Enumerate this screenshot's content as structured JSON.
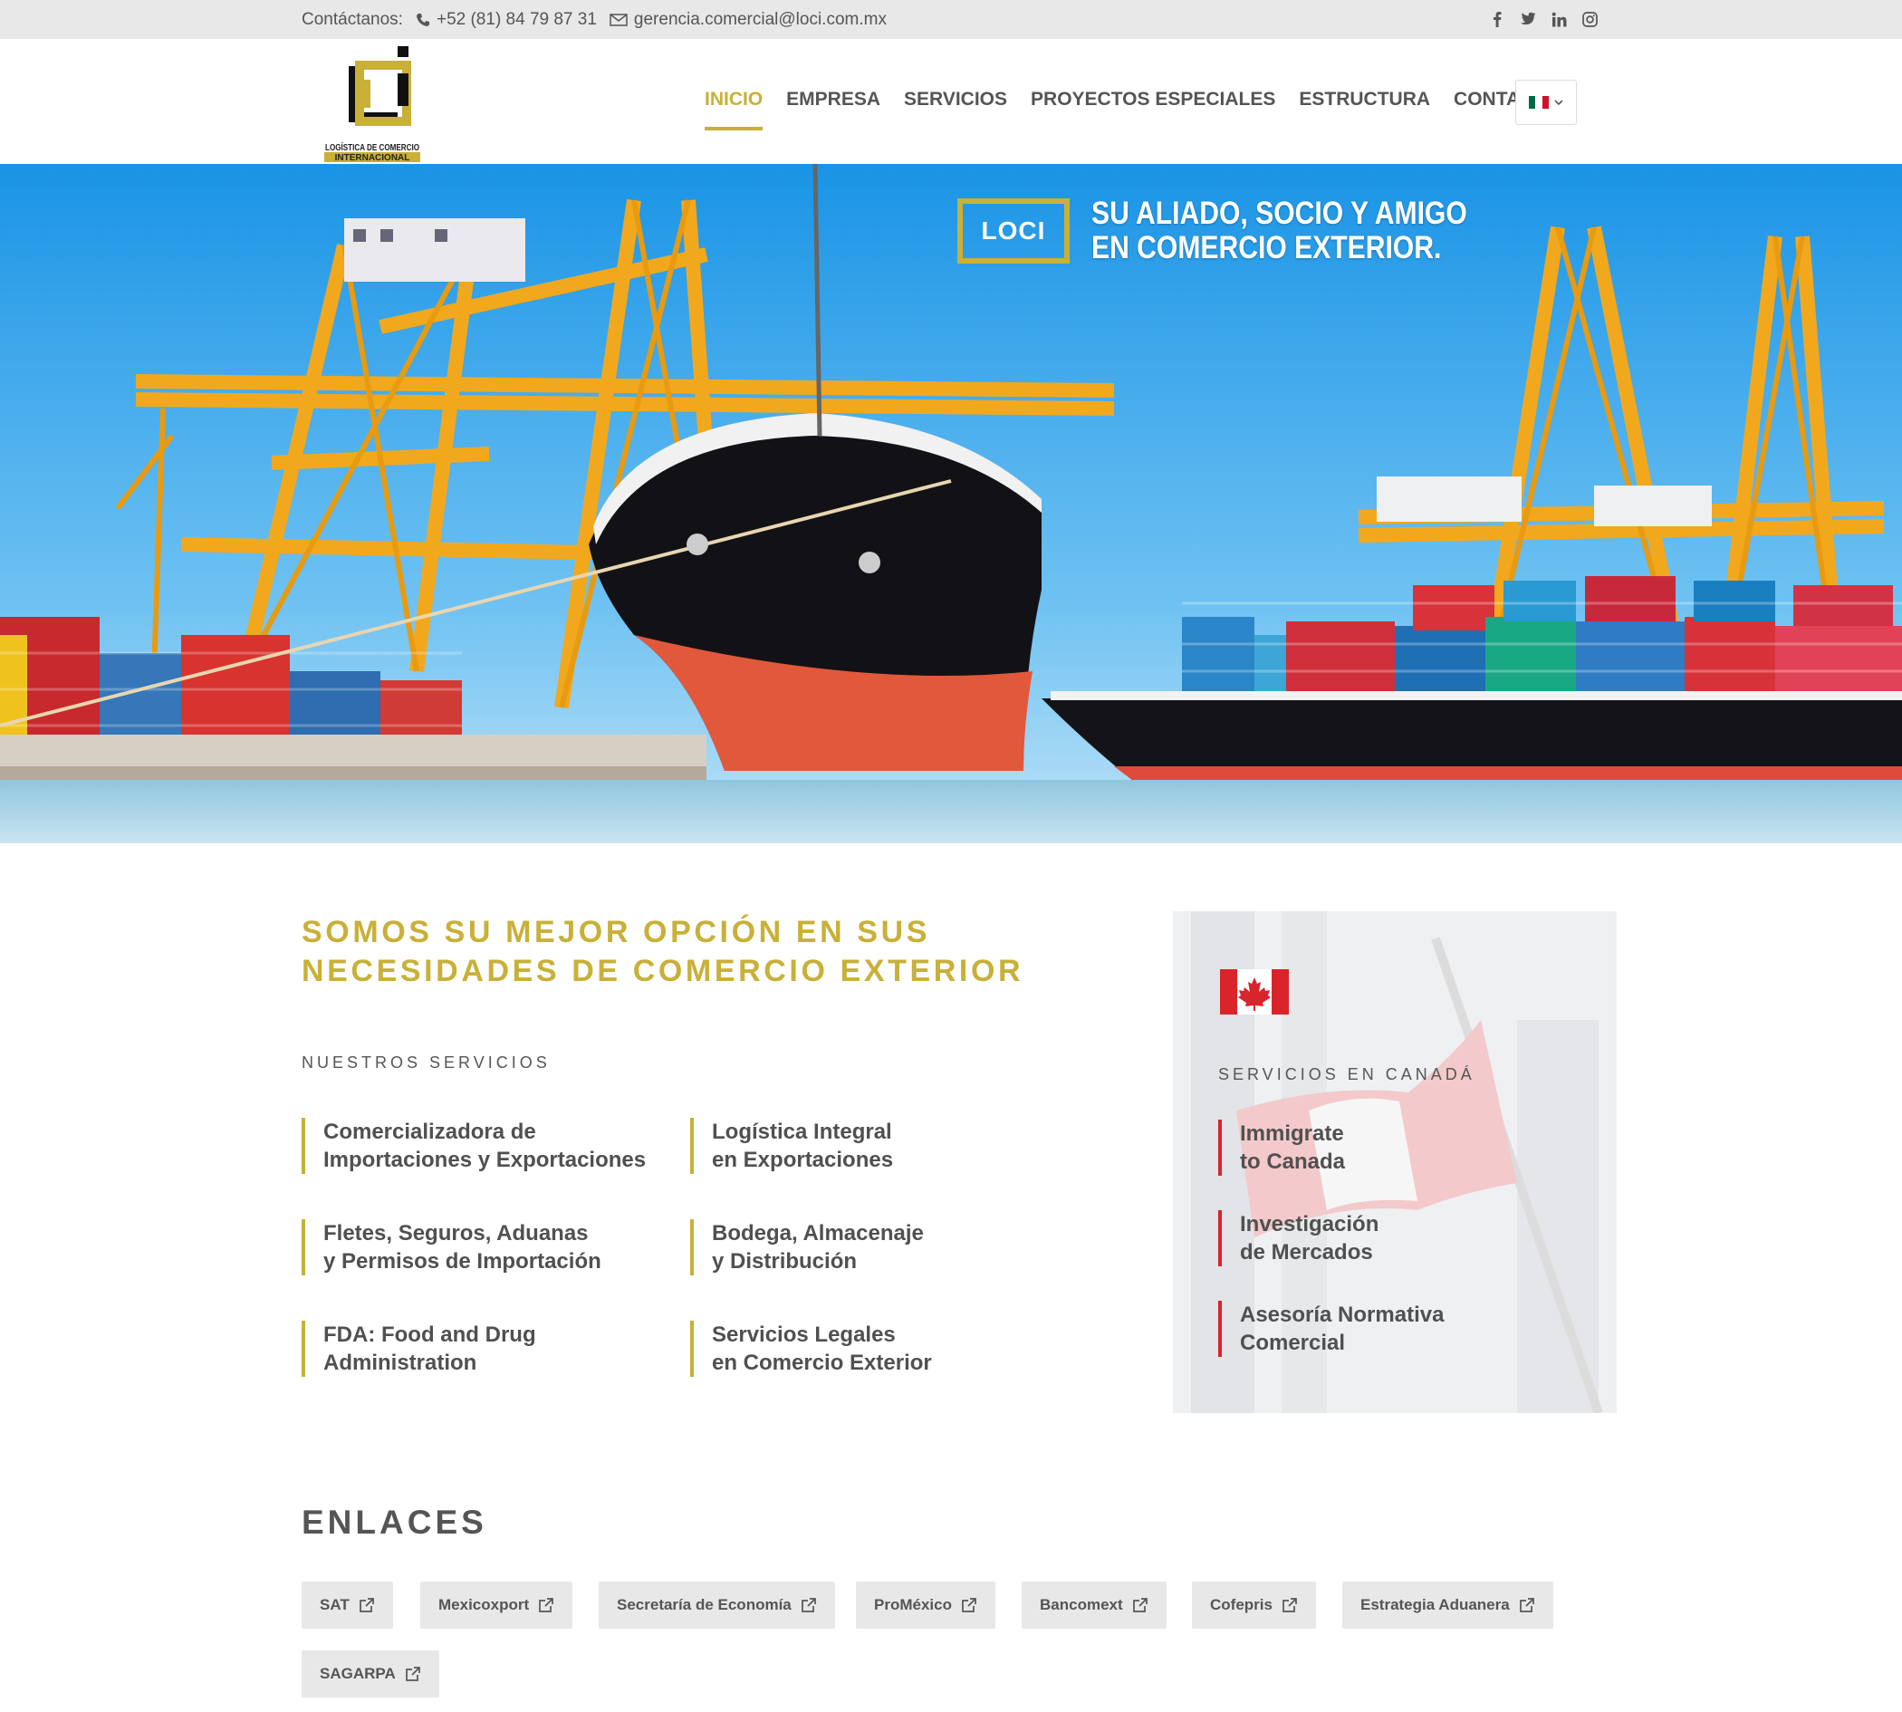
{
  "topbar": {
    "contact_label": "Contáctanos:",
    "phone": "+52 (81) 84 79 87 31",
    "email": "gerencia.comercial@loci.com.mx",
    "social": [
      "facebook-icon",
      "twitter-icon",
      "linkedin-icon",
      "instagram-icon"
    ]
  },
  "header": {
    "logo_text_1": "LOGÍSTICA DE COMERCIO",
    "logo_text_2": "INTERNACIONAL",
    "nav": [
      "INICIO",
      "EMPRESA",
      "SERVICIOS",
      "PROYECTOS ESPECIALES",
      "ESTRUCTURA",
      "CONTACTO"
    ],
    "active_nav": "INICIO",
    "language_flag": "mexico-flag-icon"
  },
  "hero": {
    "badge": "LOCI",
    "tagline_1": "SU ALIADO, SOCIO Y AMIGO",
    "tagline_2": "EN COMERCIO EXTERIOR."
  },
  "main": {
    "headline_1": "SOMOS SU MEJOR OPCIÓN EN SUS",
    "headline_2": "NECESIDADES DE COMERCIO EXTERIOR",
    "services_title": "NUESTROS SERVICIOS",
    "services": [
      {
        "line1": "Comercializadora de",
        "line2": "Importaciones y Exportaciones"
      },
      {
        "line1": "Logística Integral",
        "line2": "en Exportaciones"
      },
      {
        "line1": "Fletes, Seguros, Aduanas",
        "line2": "y Permisos de Importación"
      },
      {
        "line1": "Bodega, Almacenaje",
        "line2": "y Distribución"
      },
      {
        "line1": "FDA: Food and Drug",
        "line2": "Administration"
      },
      {
        "line1": "Servicios Legales",
        "line2": "en Comercio Exterior"
      }
    ]
  },
  "canada": {
    "title": "SERVICIOS EN CANADÁ",
    "services": [
      {
        "line1": "Immigrate",
        "line2": "to Canada"
      },
      {
        "line1": "Investigación",
        "line2": "de Mercados"
      },
      {
        "line1": "Asesoría Normativa",
        "line2": "Comercial"
      }
    ]
  },
  "links": {
    "title": "ENLACES",
    "items": [
      "SAT",
      "Mexicoxport",
      "Secretaría de Economía",
      "ProMéxico",
      "Bancomext",
      "Cofepris",
      "Estrategia Aduanera",
      "SAGARPA"
    ]
  },
  "colors": {
    "accent": "#c9b037",
    "canada_red": "#d9242b",
    "text": "#555555"
  }
}
